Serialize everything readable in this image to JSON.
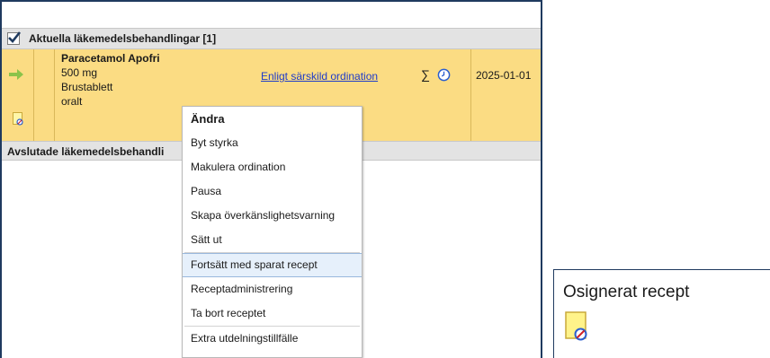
{
  "section_current": {
    "label": "Aktuella läkemedelsbehandlingar [1]",
    "checked": true
  },
  "medication": {
    "name": "Paracetamol Apofri",
    "strength": "500 mg",
    "form": "Brustablett",
    "route": "oralt",
    "ordination_link": "Enligt särskild ordination",
    "sigma_symbol": "∑",
    "date": "2025-01-01",
    "row_color": "#fbdc83",
    "icons": [
      "arrow-right-icon",
      "unsigned-prescription-icon",
      "clock-icon"
    ]
  },
  "section_ended": {
    "label": "Avslutade läkemedelsbehandli"
  },
  "context_menu": {
    "title": "Ändra",
    "items": [
      "Byt styrka",
      "Makulera ordination",
      "Pausa",
      "Skapa överkänslighetsvarning",
      "Sätt ut",
      "Fortsätt med sparat recept",
      "Receptadministrering",
      "Ta bort receptet",
      "Extra utdelningstillfälle"
    ],
    "selected": "Fortsätt med sparat recept"
  },
  "legend": {
    "label": "Osignerat recept",
    "icon": "unsigned-prescription-icon"
  }
}
